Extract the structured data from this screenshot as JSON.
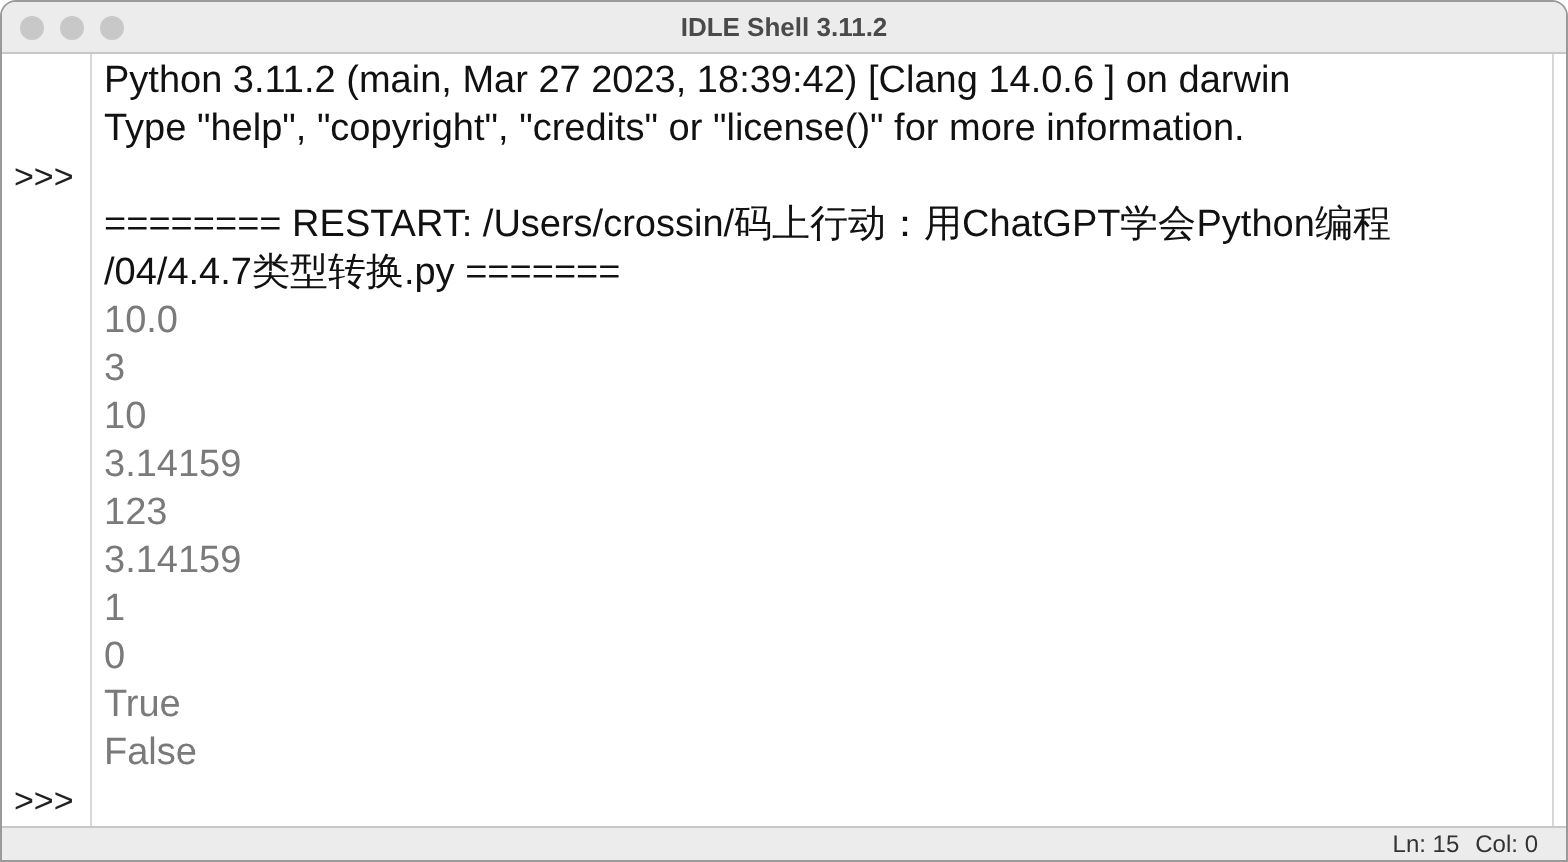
{
  "window": {
    "title": "IDLE Shell 3.11.2"
  },
  "lines": [
    {
      "kind": "info",
      "text": "Python 3.11.2 (main, Mar 27 2023, 18:39:42) [Clang 14.0.6 ] on darwin"
    },
    {
      "kind": "info",
      "text": "Type \"help\", \"copyright\", \"credits\" or \"license()\" for more information."
    },
    {
      "kind": "prompt",
      "prompt": ">>>"
    },
    {
      "kind": "info",
      "text": "======== RESTART: /Users/crossin/码上行动：用ChatGPT学会Python编程"
    },
    {
      "kind": "info",
      "text": "/04/4.4.7类型转换.py ======="
    },
    {
      "kind": "output",
      "text": "10.0"
    },
    {
      "kind": "output",
      "text": "3"
    },
    {
      "kind": "output",
      "text": "10"
    },
    {
      "kind": "output",
      "text": "3.14159"
    },
    {
      "kind": "output",
      "text": "123"
    },
    {
      "kind": "output",
      "text": "3.14159"
    },
    {
      "kind": "output",
      "text": "1"
    },
    {
      "kind": "output",
      "text": "0"
    },
    {
      "kind": "output",
      "text": "True"
    },
    {
      "kind": "output",
      "text": "False"
    },
    {
      "kind": "prompt",
      "prompt": ">>>"
    }
  ],
  "status_bar": {
    "line": "Ln: 15",
    "column": "Col: 0"
  }
}
